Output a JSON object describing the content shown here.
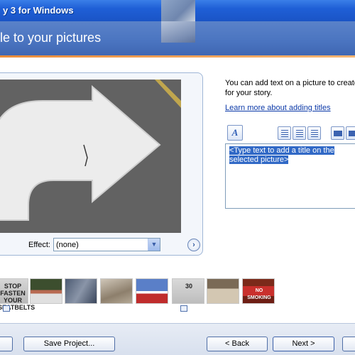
{
  "window": {
    "title": "y 3 for Windows"
  },
  "header": {
    "heading": "le to your pictures"
  },
  "main": {
    "effect_label": "Effect:",
    "effect_value": "(none)",
    "help_text_line1": "You can add text on a picture to create a",
    "help_text_line2": "for your story.",
    "help_link": "Learn more about adding titles",
    "font_button_glyph": "A",
    "title_placeholder_line1": "<Type text to add a title on the",
    "title_placeholder_line2": "selected picture>"
  },
  "filmstrip": {
    "thumbs": [
      {
        "label": "STOP FASTEN YOUR SEATBELTS"
      },
      {
        "label": ""
      },
      {
        "label": ""
      },
      {
        "label": ""
      },
      {
        "label": ""
      },
      {
        "label": "30"
      },
      {
        "label": ""
      },
      {
        "label": "NO SMOKING"
      }
    ]
  },
  "buttons": {
    "save_project": "Save Project...",
    "back": "< Back",
    "next": "Next >"
  },
  "icons": {
    "next_effect": "chevron-right-icon",
    "dropdown": "chevron-down-icon",
    "font": "font-icon",
    "align_left": "align-left-icon",
    "align_center": "align-center-icon",
    "align_right": "align-right-icon"
  },
  "colors": {
    "title_bar": "#1f5fd6",
    "header": "#4a74c0",
    "accent_line": "#e98b3a",
    "selection": "#3169c6",
    "link": "#0b39a8"
  }
}
